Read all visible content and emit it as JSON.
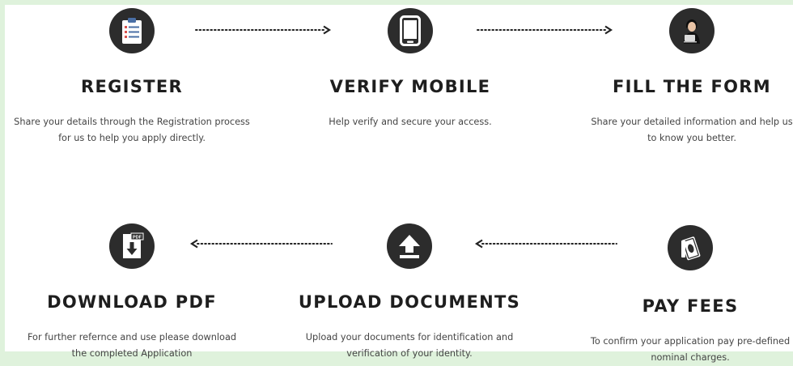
{
  "steps": {
    "register": {
      "title": "REGISTER",
      "desc_line1": "Share your details through the Registration process",
      "desc_line2": "for us to help you apply directly.",
      "icon": "clipboard-icon"
    },
    "verify_mobile": {
      "title": "VERIFY MOBILE",
      "desc_line1": "Help verify and secure your access.",
      "icon": "smartphone-icon"
    },
    "fill_form": {
      "title": "FILL THE FORM",
      "desc_line1": "Share your detailed information and help us",
      "desc_line2": "to know you better.",
      "icon": "person-laptop-icon"
    },
    "download_pdf": {
      "title": "DOWNLOAD PDF",
      "desc_line1": "For further refernce and use please download",
      "desc_line2": "the completed Application",
      "icon": "pdf-download-icon",
      "badge": "PDF"
    },
    "upload_documents": {
      "title": "UPLOAD DOCUMENTS",
      "desc_line1": "Upload your documents for identification and",
      "desc_line2": "verification of your identity.",
      "icon": "upload-icon"
    },
    "pay_fees": {
      "title": "PAY FEES",
      "desc_line1": "To confirm your application pay pre-defined",
      "desc_line2": "nominal charges.",
      "icon": "money-icon"
    }
  },
  "colors": {
    "background": "#dff2dc",
    "icon_circle": "#2c2c2c",
    "title": "#1e1e1e",
    "text": "#444444"
  }
}
